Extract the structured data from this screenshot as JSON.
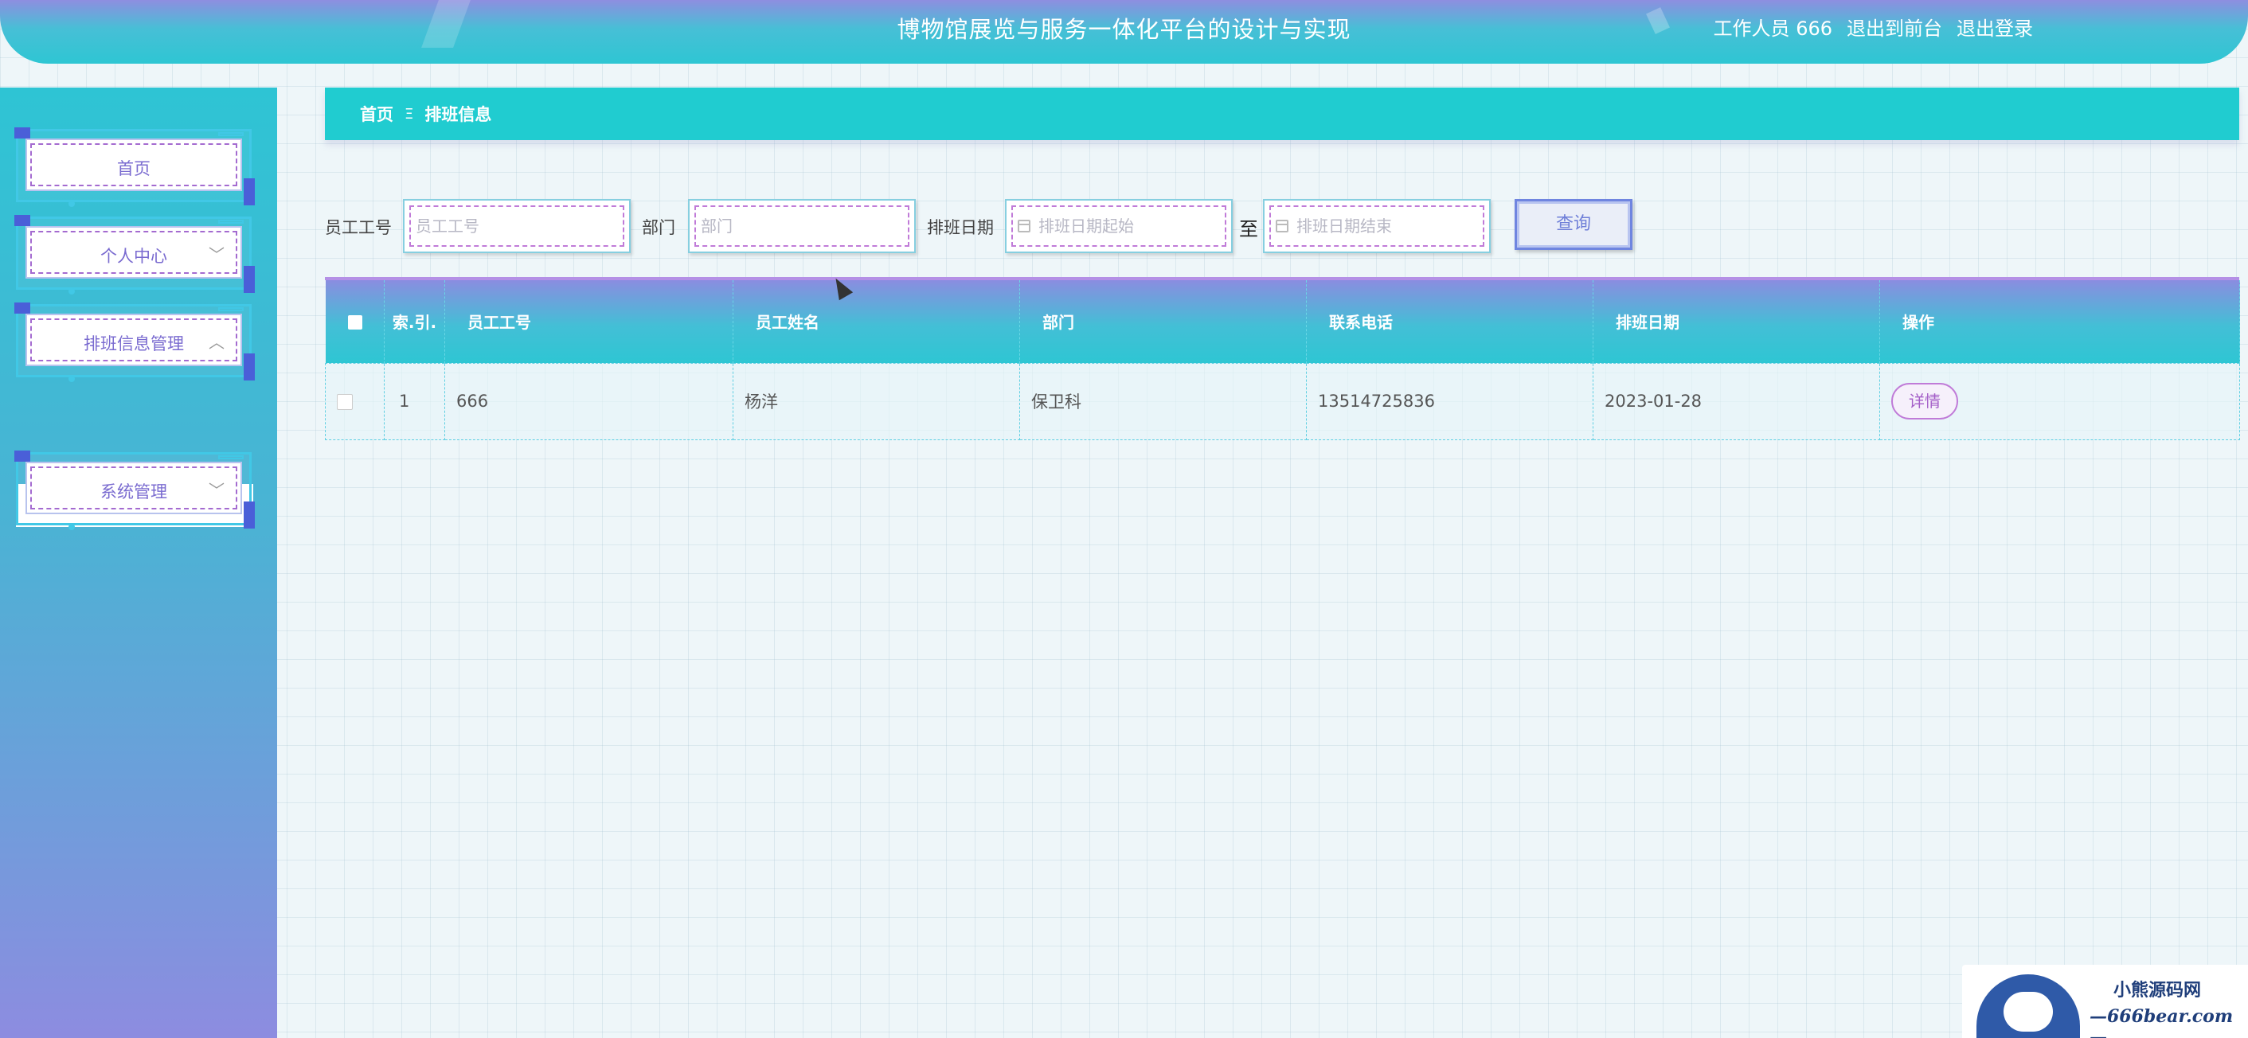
{
  "header": {
    "title": "博物馆展览与服务一体化平台的设计与实现",
    "user_label": "工作人员 666",
    "front_link": "退出到前台",
    "logout_link": "退出登录"
  },
  "sidebar": {
    "items": [
      {
        "label": "首页"
      },
      {
        "label": "个人中心"
      },
      {
        "label": "排班信息管理"
      },
      {
        "label": "系统管理"
      }
    ],
    "sub_item": "排班信息"
  },
  "breadcrumb": {
    "home": "首页",
    "separator": "Ξ",
    "current": "排班信息"
  },
  "filters": {
    "employee_id_label": "员工工号",
    "employee_id_placeholder": "员工工号",
    "dept_label": "部门",
    "dept_placeholder": "部门",
    "date_label": "排班日期",
    "date_start_placeholder": "排班日期起始",
    "date_to": "至",
    "date_end_placeholder": "排班日期结束",
    "query_button": "查询"
  },
  "table": {
    "columns": [
      "索.引.",
      "员工工号",
      "员工姓名",
      "部门",
      "联系电话",
      "排班日期",
      "操作"
    ],
    "rows": [
      {
        "index": "1",
        "employee_id": "666",
        "name": "杨洋",
        "dept": "保卫科",
        "phone": "13514725836",
        "date": "2023-01-28",
        "action": "详情"
      }
    ]
  },
  "watermark": {
    "line1": "小熊源码网",
    "line2": "—666bear.com—"
  }
}
